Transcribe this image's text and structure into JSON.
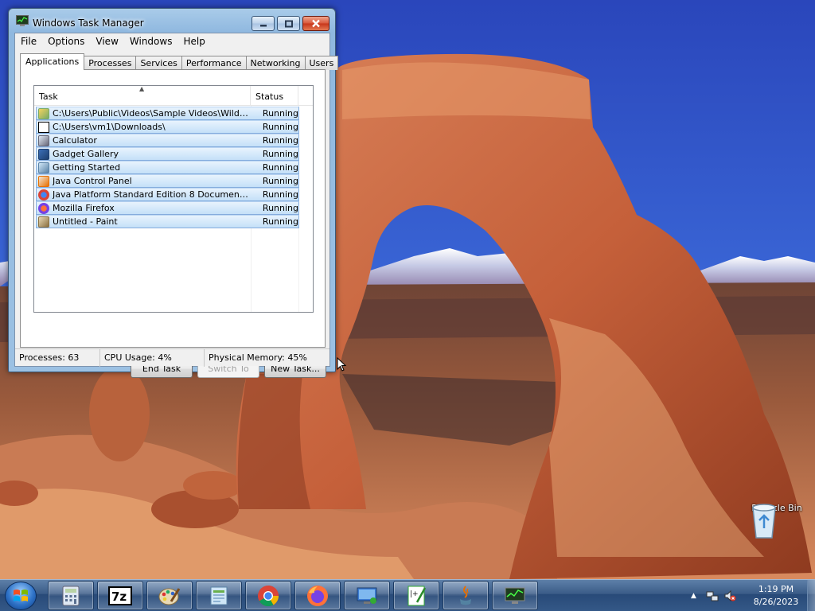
{
  "window": {
    "title": "Windows Task Manager",
    "menu": [
      "File",
      "Options",
      "View",
      "Windows",
      "Help"
    ],
    "tabs": [
      "Applications",
      "Processes",
      "Services",
      "Performance",
      "Networking",
      "Users"
    ],
    "active_tab": "Applications",
    "columns": {
      "task": "Task",
      "status": "Status"
    },
    "tasks": [
      {
        "name": "C:\\Users\\Public\\Videos\\Sample Videos\\Wildlife.w...",
        "status": "Running",
        "icon": "media-file-icon"
      },
      {
        "name": "C:\\Users\\vm1\\Downloads\\",
        "status": "Running",
        "icon": "7zip-icon"
      },
      {
        "name": "Calculator",
        "status": "Running",
        "icon": "calculator-icon"
      },
      {
        "name": "Gadget Gallery",
        "status": "Running",
        "icon": "gadget-icon"
      },
      {
        "name": "Getting Started",
        "status": "Running",
        "icon": "getting-started-icon"
      },
      {
        "name": "Java Control Panel",
        "status": "Running",
        "icon": "java-icon"
      },
      {
        "name": "Java Platform Standard Edition 8 Documentation...",
        "status": "Running",
        "icon": "chrome-icon"
      },
      {
        "name": "Mozilla Firefox",
        "status": "Running",
        "icon": "firefox-icon"
      },
      {
        "name": "Untitled - Paint",
        "status": "Running",
        "icon": "paint-icon"
      }
    ],
    "buttons": {
      "end_task": "End Task",
      "switch_to": "Switch To",
      "new_task": "New Task..."
    },
    "status": {
      "processes": "Processes: 63",
      "cpu": "CPU Usage: 4%",
      "memory": "Physical Memory: 45%"
    }
  },
  "desktop": {
    "recycle_bin": "Recycle Bin"
  },
  "taskbar": {
    "items": [
      "calculator-icon",
      "7zip-icon",
      "paint-icon",
      "getting-started-icon",
      "chrome-icon",
      "firefox-icon",
      "control-panel-icon",
      "java-doc-icon",
      "java-icon",
      "task-manager-icon"
    ],
    "time": "1:19 PM",
    "date": "8/26/2023"
  },
  "colors": {
    "selection_row": "#c4e0f8",
    "taskbar": "#345887",
    "sky": "#2b4fc0"
  }
}
